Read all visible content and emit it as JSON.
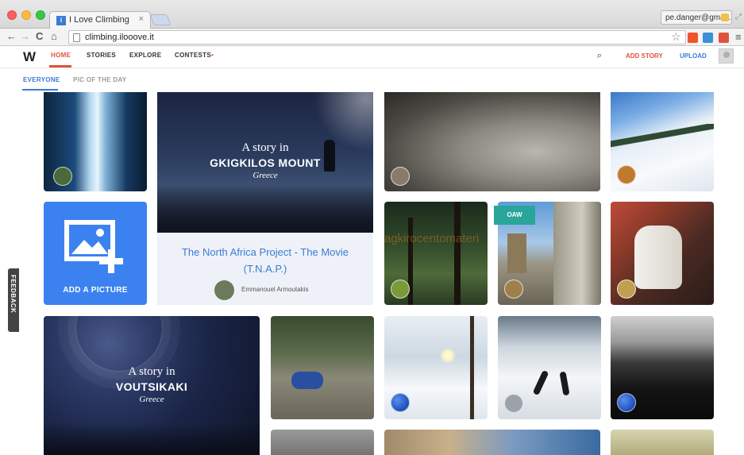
{
  "browser": {
    "tab_title": "I Love Climbing",
    "tab_favicon_letter": "i",
    "tab_close": "×",
    "profile_email": "pe.danger@gmai...",
    "url": "climbing.ilooove.it",
    "back": "←",
    "forward": "→",
    "reload": "C",
    "home": "⌂",
    "star": "☆",
    "menu": "≡",
    "ext_labels": [
      "",
      "",
      ""
    ]
  },
  "site": {
    "logo": "W",
    "nav": [
      "HOME",
      "STORIES",
      "EXPLORE",
      "CONTESTS"
    ],
    "contest_dot": "•",
    "search_icon": "⌕",
    "add_story": "ADD STORY",
    "upload": "UPLOAD",
    "subnav": [
      "EVERYONE",
      "PIC OF THE DAY"
    ],
    "feedback": "FEEDBACK"
  },
  "feed": {
    "story1": {
      "kicker": "A story in",
      "title": "GKIGKILOS MOUNT",
      "country": "Greece"
    },
    "story2": {
      "kicker": "A story in",
      "title": "VOUTSIKAKI",
      "country": "Greece"
    },
    "tnap": {
      "title": "The North Africa Project - The Movie (T.N.A.P.)",
      "author": "Emmanouel Armoutakis"
    },
    "add_picture": "ADD A PICTURE",
    "oaw_badge": "OAW",
    "watermark": "agkirocentomateri"
  },
  "colors": {
    "accent_red": "#e0523e",
    "accent_blue": "#3a7bd5",
    "add_card_blue": "#3b82f0",
    "oaw_teal": "#2aa59a"
  }
}
